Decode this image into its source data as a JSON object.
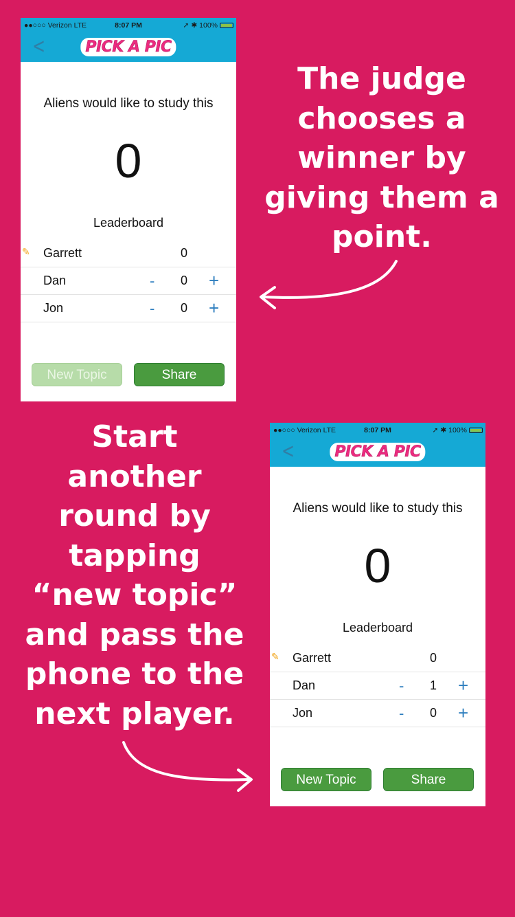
{
  "colors": {
    "background": "#d81b60",
    "header": "#15a9d5",
    "button_green": "#4a9b3f",
    "button_disabled": "#b7dca9",
    "stepper_blue": "#2f7fbf"
  },
  "caption_top": {
    "lines": [
      "The judge",
      "chooses a",
      "winner by",
      "giving them a",
      "point."
    ]
  },
  "caption_bottom": {
    "lines": [
      "Start",
      "another",
      "round by",
      "tapping",
      "“new topic”",
      "and pass the",
      "phone to the",
      "next player."
    ]
  },
  "phone1": {
    "status": {
      "carrier": "●●○○○ Verizon  LTE",
      "time": "8:07 PM",
      "battery": "100%"
    },
    "logo": "PICK A PIC",
    "back_icon": "chevron-left-icon",
    "topic": "Aliens would like to study this",
    "score": "0",
    "leaderboard_title": "Leaderboard",
    "players": [
      {
        "name": "Garrett",
        "points": "0",
        "judge": true
      },
      {
        "name": "Dan",
        "points": "0",
        "minus": "-",
        "plus": "+"
      },
      {
        "name": "Jon",
        "points": "0",
        "minus": "-",
        "plus": "+"
      }
    ],
    "new_topic_label": "New Topic",
    "share_label": "Share"
  },
  "phone2": {
    "status": {
      "carrier": "●●○○○ Verizon  LTE",
      "time": "8:07 PM",
      "battery": "100%"
    },
    "logo": "PICK A PIC",
    "back_icon": "chevron-left-icon",
    "topic": "Aliens would like to study this",
    "score": "0",
    "leaderboard_title": "Leaderboard",
    "players": [
      {
        "name": "Garrett",
        "points": "0",
        "judge": true
      },
      {
        "name": "Dan",
        "points": "1",
        "minus": "-",
        "plus": "+"
      },
      {
        "name": "Jon",
        "points": "0",
        "minus": "-",
        "plus": "+"
      }
    ],
    "new_topic_label": "New Topic",
    "share_label": "Share"
  }
}
